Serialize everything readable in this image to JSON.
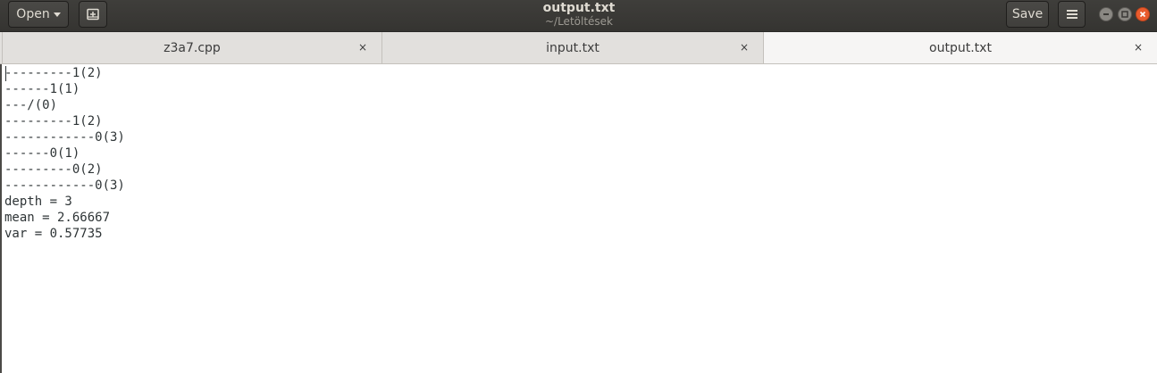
{
  "header": {
    "open_label": "Open",
    "title": "output.txt",
    "subtitle": "~/Letöltések",
    "save_label": "Save"
  },
  "tabs": [
    {
      "label": "z3a7.cpp",
      "close": "×"
    },
    {
      "label": "input.txt",
      "close": "×"
    },
    {
      "label": "output.txt",
      "close": "×",
      "active": true
    }
  ],
  "editor": {
    "lines": [
      "---------1(2)",
      "------1(1)",
      "---/(0)",
      "---------1(2)",
      "------------0(3)",
      "------0(1)",
      "---------0(2)",
      "------------0(3)",
      "depth = 3",
      "mean = 2.66667",
      "var = 0.57735"
    ]
  },
  "colors": {
    "headerbar": "#3a3936",
    "close_button": "#e95b2d",
    "text": "#2e3436"
  }
}
